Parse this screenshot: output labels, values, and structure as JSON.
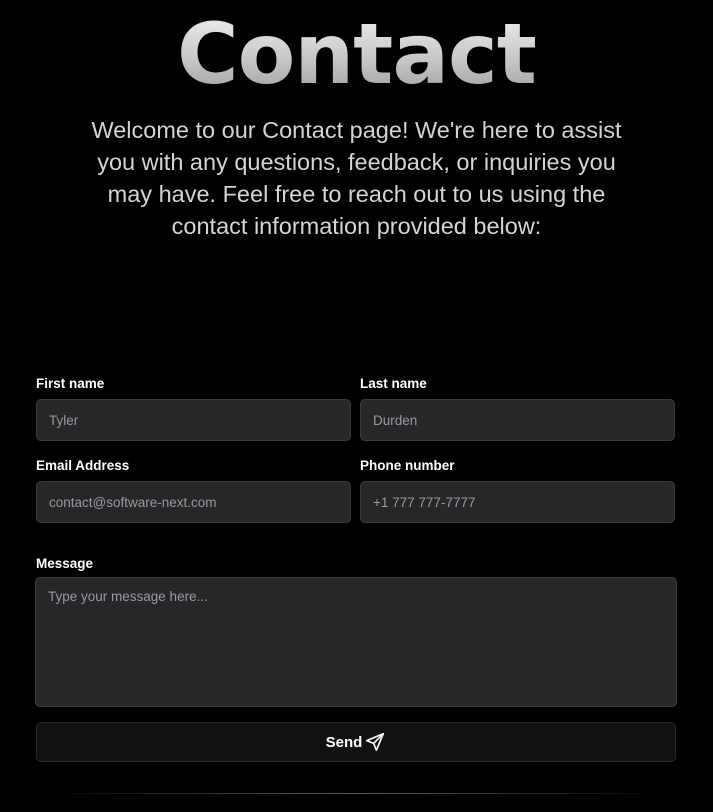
{
  "header": {
    "title": "Contact",
    "intro": "Welcome to our Contact page! We're here to assist you with any questions, feedback, or inquiries you may have. Feel free to reach out to us using the contact information provided below:"
  },
  "form": {
    "first_name": {
      "label": "First name",
      "placeholder": "Tyler"
    },
    "last_name": {
      "label": "Last name",
      "placeholder": "Durden"
    },
    "email": {
      "label": "Email Address",
      "placeholder": "contact@software-next.com"
    },
    "phone": {
      "label": "Phone number",
      "placeholder": "+1 777 777-7777"
    },
    "message": {
      "label": "Message",
      "placeholder": "Type your message here..."
    },
    "submit": {
      "label": "Send",
      "icon": "send-icon"
    }
  },
  "colors": {
    "background": "#000000",
    "field_background": "#27272a",
    "button_background": "#121214",
    "text": "#ffffff"
  }
}
